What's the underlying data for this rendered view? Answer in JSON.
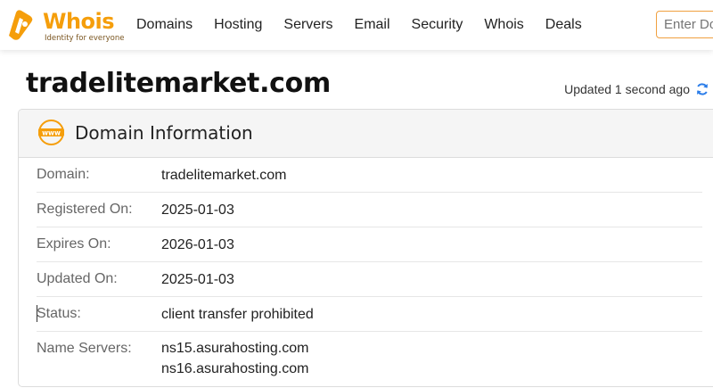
{
  "header": {
    "logo_text": "Whois",
    "logo_tagline": "Identity for everyone",
    "nav": [
      "Domains",
      "Hosting",
      "Servers",
      "Email",
      "Security",
      "Whois",
      "Deals"
    ],
    "search_placeholder": "Enter Do"
  },
  "page": {
    "title": "tradelitemarket.com",
    "updated_text": "Updated 1 second ago"
  },
  "card": {
    "title": "Domain Information",
    "rows": [
      {
        "label": "Domain:",
        "value": "tradelitemarket.com"
      },
      {
        "label": "Registered On:",
        "value": "2025-01-03"
      },
      {
        "label": "Expires On:",
        "value": "2026-01-03"
      },
      {
        "label": "Updated On:",
        "value": "2025-01-03"
      },
      {
        "label": "Status:",
        "value": "client transfer prohibited"
      },
      {
        "label": "Name Servers:",
        "value": "ns15.asurahosting.com",
        "value2": "ns16.asurahosting.com"
      }
    ]
  },
  "colors": {
    "brand_orange": "#f59e0b",
    "refresh_blue": "#2b7de9",
    "search_border": "#f0a040"
  },
  "icons": {
    "logo": "whois-logo-icon",
    "www": "www-globe-icon",
    "refresh": "refresh-icon"
  }
}
